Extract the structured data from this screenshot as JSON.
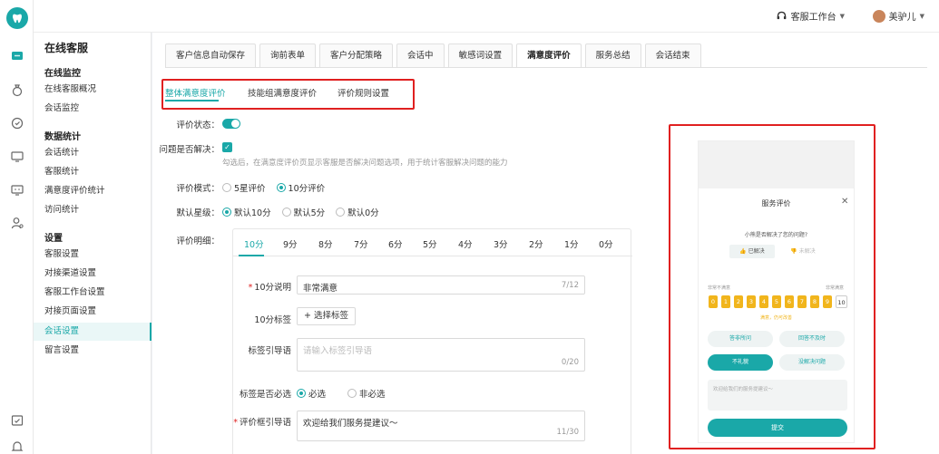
{
  "topbar": {
    "workbench": "客服工作台",
    "user": "美驴儿"
  },
  "nav": {
    "title": "在线客服",
    "groups": [
      {
        "label": "在线监控",
        "items": [
          "在线客服概况",
          "会话监控"
        ]
      },
      {
        "label": "数据统计",
        "items": [
          "会话统计",
          "客服统计",
          "满意度评价统计",
          "访问统计"
        ]
      },
      {
        "label": "设置",
        "items": [
          "客服设置",
          "对接渠道设置",
          "客服工作台设置",
          "对接页面设置",
          "会话设置",
          "留言设置"
        ]
      }
    ],
    "active": "会话设置"
  },
  "tabs": [
    "客户信息自动保存",
    "询前表单",
    "客户分配策略",
    "会话中",
    "敏感词设置",
    "满意度评价",
    "服务总结",
    "会话结束"
  ],
  "active_tab": "满意度评价",
  "subtabs": [
    "整体满意度评价",
    "技能组满意度评价",
    "评价规则设置"
  ],
  "form": {
    "status_label": "评价状态：",
    "solved_label": "问题是否解决：",
    "solved_hint": "勾选后，在满意度评价页显示客服是否解决问题选项，用于统计客服解决问题的能力",
    "mode_label": "评价模式：",
    "mode_options": [
      "5星评价",
      "10分评价"
    ],
    "default_label": "默认星级：",
    "default_options": [
      "默认10分",
      "默认5分",
      "默认0分"
    ],
    "detail_label": "评价明细：",
    "scores": [
      "10分",
      "9分",
      "8分",
      "7分",
      "6分",
      "5分",
      "4分",
      "3分",
      "2分",
      "1分",
      "0分"
    ],
    "desc_label": "10分说明",
    "desc_value": "非常满意",
    "desc_count": "7/12",
    "tag_label": "10分标签",
    "tag_button": "+ 选择标签",
    "guide_label": "标签引导语",
    "guide_placeholder": "请输入标签引导语",
    "guide_count": "0/20",
    "required_label": "标签是否必选",
    "required_options": [
      "必选",
      "非必选"
    ],
    "praise_label": "评价框引导语",
    "praise_value": "欢迎给我们服务提建议～",
    "praise_count": "11/30"
  },
  "preview": {
    "title": "服务评价",
    "question": "小熊是否解决了您的问题?",
    "solved": "已解决",
    "unsolved": "未解决",
    "left_caption": "非常不满意",
    "right_caption": "非常满意",
    "cells": [
      "0",
      "1",
      "2",
      "3",
      "4",
      "5",
      "6",
      "7",
      "8",
      "9",
      "10"
    ],
    "note": "满意，仍可改善",
    "chips": [
      "答非所问",
      "回答不及时",
      "不礼貌",
      "没解决问题"
    ],
    "placeholder": "欢迎给我们的服务提建议～",
    "submit": "提交"
  },
  "colors": {
    "accent": "#1aa8a8",
    "highlight": "#e02020",
    "score": "#f1b51c"
  }
}
